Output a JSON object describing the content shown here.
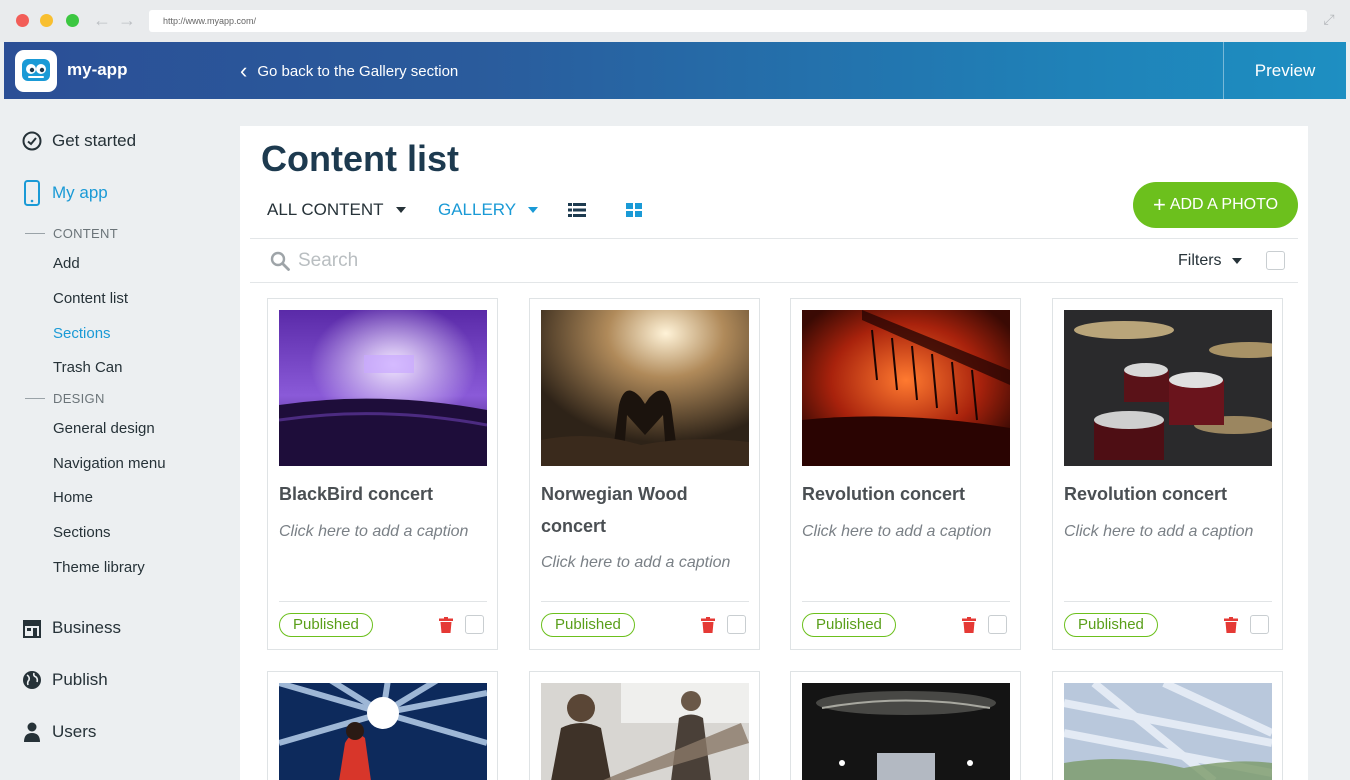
{
  "browser": {
    "url": "http://www.myapp.com/"
  },
  "header": {
    "app_name": "my-app",
    "back_label": "Go back to the Gallery section",
    "preview_label": "Preview"
  },
  "sidebar": {
    "main": [
      {
        "label": "Get started",
        "icon": "check-circle-icon"
      },
      {
        "label": "My app",
        "icon": "phone-icon",
        "active": true
      },
      {
        "label": "Business",
        "icon": "store-icon"
      },
      {
        "label": "Publish",
        "icon": "globe-icon"
      },
      {
        "label": "Users",
        "icon": "user-icon"
      }
    ],
    "content_section": "CONTENT",
    "content_items": [
      "Add",
      "Content list",
      "Sections",
      "Trash Can"
    ],
    "design_section": "DESIGN",
    "design_items": [
      "General design",
      "Navigation menu",
      "Home",
      "Sections",
      "Theme library"
    ]
  },
  "main": {
    "title": "Content list",
    "filter_all": "ALL CONTENT",
    "filter_gallery": "GALLERY",
    "add_photo": "ADD A PHOTO",
    "search_placeholder": "Search",
    "filters_label": "Filters",
    "cards": [
      {
        "title": "BlackBird concert",
        "caption": "Click here to add a caption",
        "status": "Published"
      },
      {
        "title": "Norwegian Wood concert",
        "caption": "Click here to add a caption",
        "status": "Published"
      },
      {
        "title": "Revolution concert",
        "caption": "Click here to add a caption",
        "status": "Published"
      },
      {
        "title": "Revolution concert",
        "caption": "Click here to add a caption",
        "status": "Published"
      }
    ]
  },
  "colors": {
    "accent": "#1a9ad6",
    "green": "#6cc01d",
    "trash": "#e53935",
    "title": "#1d3a4f"
  }
}
